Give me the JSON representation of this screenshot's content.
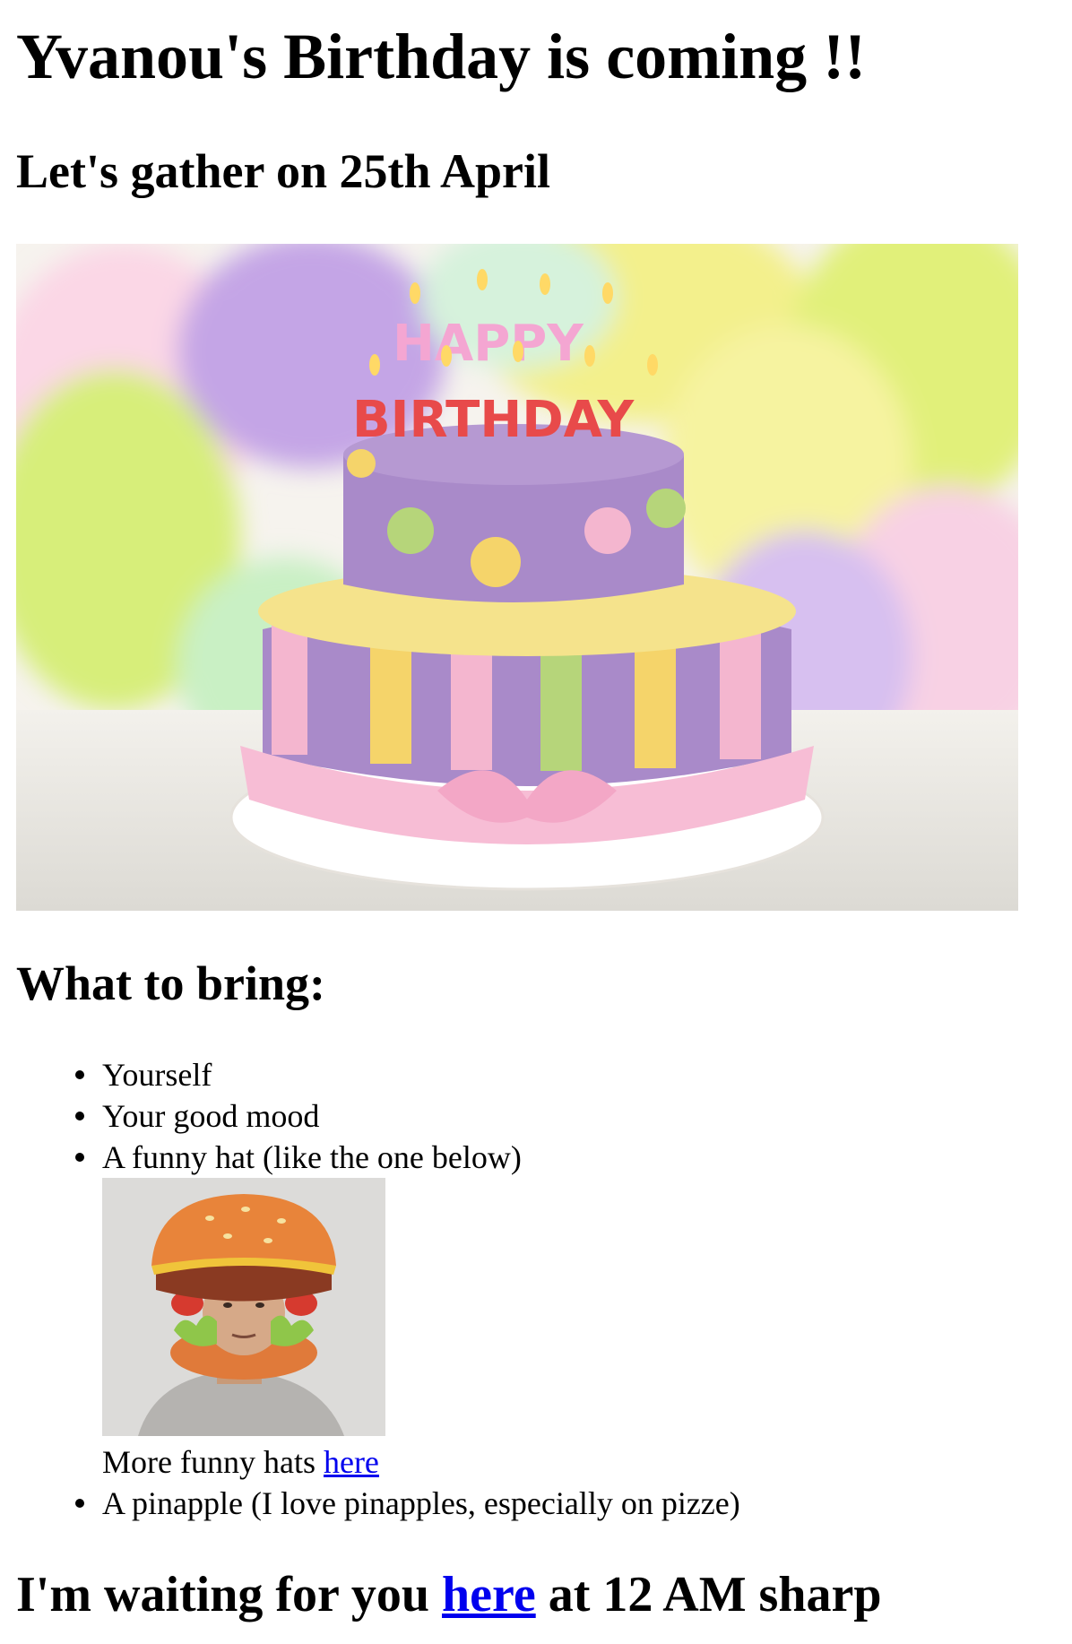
{
  "header": {
    "title": "Yvanou's Birthday is coming !!",
    "subtitle": "Let's gather on 25th April"
  },
  "hero_image": {
    "cake_lettering": [
      "HAPPY",
      "BIRTHDAY"
    ],
    "colors": {
      "cake_purple": "#a98ac9",
      "stripe_pink": "#f4b6cf",
      "stripe_yellow": "#f5d46a",
      "stripe_green": "#b6d57a",
      "balloon_green": "#d7ee7a",
      "balloon_yellow": "#f3f08c",
      "balloon_purple": "#c4a5e6"
    }
  },
  "bring_section": {
    "heading": "What to bring:",
    "items": [
      {
        "text": "Yourself"
      },
      {
        "text": "Your good mood"
      },
      {
        "text": "A funny hat (like the one below)"
      },
      {
        "text": "A pinapple (I love pinapples, especially on pizze)"
      }
    ],
    "more_hats_text": "More funny hats ",
    "more_hats_link": "here"
  },
  "footer": {
    "waiting_prefix": "I'm waiting for you ",
    "waiting_link": "here",
    "waiting_suffix": " at 12 AM sharp"
  },
  "colors": {
    "link": "#0000ee",
    "text": "#000000"
  }
}
